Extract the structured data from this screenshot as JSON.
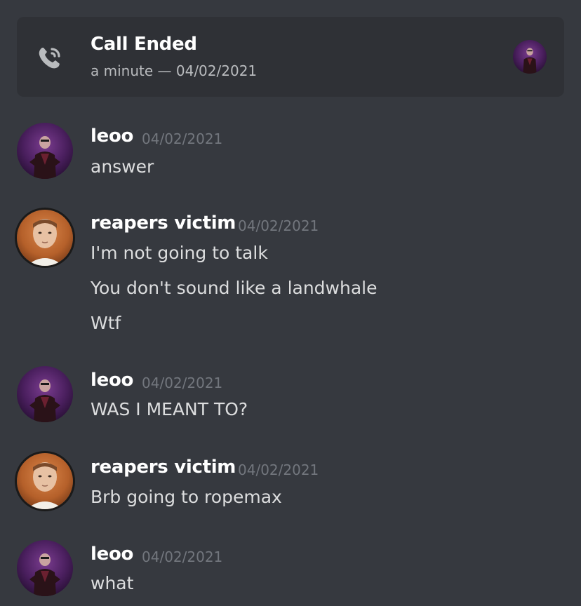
{
  "call": {
    "title": "Call Ended",
    "subtitle": "a minute — 04/02/2021",
    "icon": "phone-call-icon",
    "participant_avatar": "leoo-avatar"
  },
  "messages": [
    {
      "author": "leoo",
      "timestamp": "04/02/2021",
      "avatar": "leoo-avatar",
      "lines": [
        "answer"
      ]
    },
    {
      "author": "reapers victim",
      "timestamp": "04/02/2021",
      "avatar": "reapers-victim-avatar",
      "lines": [
        "I'm not going to talk",
        "You don't sound like a landwhale",
        "Wtf"
      ]
    },
    {
      "author": "leoo",
      "timestamp": "04/02/2021",
      "avatar": "leoo-avatar",
      "lines": [
        "WAS I MEANT TO?"
      ]
    },
    {
      "author": "reapers victim",
      "timestamp": "04/02/2021",
      "avatar": "reapers-victim-avatar",
      "lines": [
        "Brb going to ropemax"
      ]
    },
    {
      "author": "leoo",
      "timestamp": "04/02/2021",
      "avatar": "leoo-avatar",
      "lines": [
        "what"
      ]
    }
  ],
  "colors": {
    "background": "#36393f",
    "card": "#2f3136",
    "username": "#ffffff",
    "text": "#dcddde",
    "timestamp": "#72767d",
    "subtext": "#b9bbbe"
  }
}
